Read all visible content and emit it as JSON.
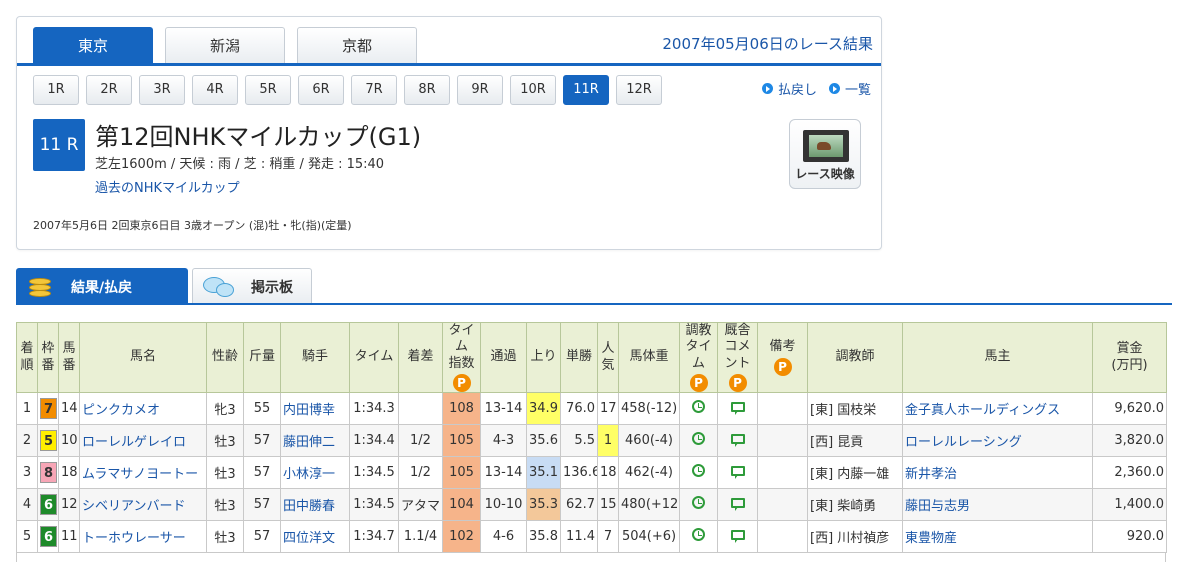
{
  "venues": [
    {
      "label": "東京",
      "active": true
    },
    {
      "label": "新潟",
      "active": false
    },
    {
      "label": "京都",
      "active": false
    }
  ],
  "result_date": "2007年05月06日のレース結果",
  "races": [
    "1R",
    "2R",
    "3R",
    "4R",
    "5R",
    "6R",
    "7R",
    "8R",
    "9R",
    "10R",
    "11R",
    "12R"
  ],
  "active_race": "11R",
  "links": {
    "payout": "払戻し",
    "list": "一覧"
  },
  "race": {
    "badge": "11 R",
    "title": "第12回NHKマイルカップ(G1)",
    "conditions": "芝左1600m / 天候 : 雨 / 芝 : 稍重 / 発走 : 15:40",
    "past_link": "過去のNHKマイルカップ",
    "info": "2007年5月6日 2回東京6日目 3歳オープン (混)牡・牝(指)(定量)",
    "video_label": "レース映像"
  },
  "section_tabs": {
    "results": "結果/払戻",
    "board": "掲示板"
  },
  "table": {
    "headers": [
      "着\n順",
      "枠\n番",
      "馬\n番",
      "馬名",
      "性齢",
      "斤量",
      "騎手",
      "タイム",
      "着差",
      "タイム\n指数",
      "通過",
      "上り",
      "単勝",
      "人\n気",
      "馬体重",
      "調教\nタイム",
      "厩舎\nコメント",
      "備考",
      "調教師",
      "馬主",
      "賞金\n(万円)"
    ],
    "p_label": "P",
    "rows": [
      {
        "rank": "1",
        "waku": "7",
        "num": "14",
        "horse": "ピンクカメオ",
        "sexage": "牝3",
        "weight": "55",
        "jockey": "内田博幸",
        "time": "1:34.3",
        "margin": "",
        "index": "108",
        "pass": "13-14",
        "last3f": "34.9",
        "odds": "76.0",
        "pop": "17",
        "body": "458(-12)",
        "trainer": "[東] 国枝栄",
        "owner": "金子真人ホールディングス",
        "prize": "9,620.0"
      },
      {
        "rank": "2",
        "waku": "5",
        "num": "10",
        "horse": "ローレルゲレイロ",
        "sexage": "牡3",
        "weight": "57",
        "jockey": "藤田伸二",
        "time": "1:34.4",
        "margin": "1/2",
        "index": "105",
        "pass": "4-3",
        "last3f": "35.6",
        "odds": "5.5",
        "pop": "1",
        "body": "460(-4)",
        "trainer": "[西] 昆貢",
        "owner": "ローレルレーシング",
        "prize": "3,820.0"
      },
      {
        "rank": "3",
        "waku": "8",
        "num": "18",
        "horse": "ムラマサノヨートー",
        "sexage": "牡3",
        "weight": "57",
        "jockey": "小林淳一",
        "time": "1:34.5",
        "margin": "1/2",
        "index": "105",
        "pass": "13-14",
        "last3f": "35.1",
        "odds": "136.6",
        "pop": "18",
        "body": "462(-4)",
        "trainer": "[東] 内藤一雄",
        "owner": "新井孝治",
        "prize": "2,360.0"
      },
      {
        "rank": "4",
        "waku": "6",
        "num": "12",
        "horse": "シベリアンバード",
        "sexage": "牡3",
        "weight": "57",
        "jockey": "田中勝春",
        "time": "1:34.5",
        "margin": "アタマ",
        "index": "104",
        "pass": "10-10",
        "last3f": "35.3",
        "odds": "62.7",
        "pop": "15",
        "body": "480(+12)",
        "trainer": "[東] 柴崎勇",
        "owner": "藤田与志男",
        "prize": "1,400.0"
      },
      {
        "rank": "5",
        "waku": "6",
        "num": "11",
        "horse": "トーホウレーサー",
        "sexage": "牡3",
        "weight": "57",
        "jockey": "四位洋文",
        "time": "1:34.7",
        "margin": "1.1/4",
        "index": "102",
        "pass": "4-6",
        "last3f": "35.8",
        "odds": "11.4",
        "pop": "7",
        "body": "504(+6)",
        "trainer": "[西] 川村禎彦",
        "owner": "東豊物産",
        "prize": "920.0"
      }
    ]
  },
  "colors": {
    "accent": "#1565c0",
    "link": "#1a56a8",
    "index_bg": "#f6b48a",
    "last3f_best": "#ffff66",
    "last3f_second": "#c8dcf4",
    "last3f_third": "#f3c89a",
    "pop_first": "#ffff66",
    "waku": {
      "5": {
        "bg": "#ffee00",
        "fg": "#333333"
      },
      "6": {
        "bg": "#1e8a2a",
        "fg": "#ffffff"
      },
      "7": {
        "bg": "#f28c00",
        "fg": "#333333"
      },
      "8": {
        "bg": "#f7a6b6",
        "fg": "#333333"
      }
    }
  },
  "highlights": {
    "last3f": {
      "0": "best",
      "2": "second",
      "3": "third"
    },
    "pop": {
      "1": "first"
    }
  },
  "icons": {
    "training": "clock-icon",
    "comment": "comment-icon",
    "coin": "coin-icon",
    "board": "chat-icon",
    "video": "film-icon",
    "link": "dot-icon",
    "premium": "p-icon"
  }
}
